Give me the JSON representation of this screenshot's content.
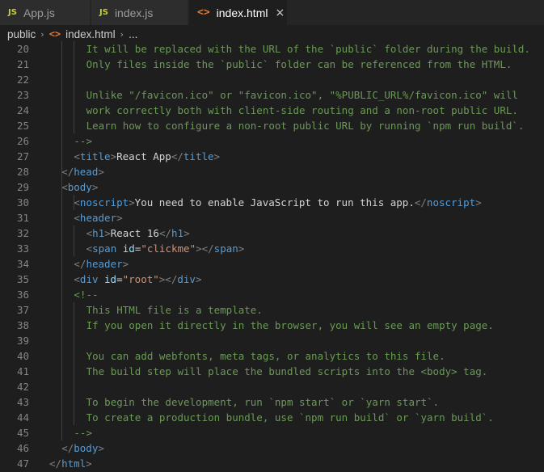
{
  "tabs": [
    {
      "badge": "JS",
      "name": "App.js",
      "active": false
    },
    {
      "badge": "JS",
      "name": "index.js",
      "active": false
    },
    {
      "badge": "<>",
      "name": "index.html",
      "active": true,
      "close": "×"
    }
  ],
  "breadcrumb": {
    "folder": "public",
    "separator": "›",
    "file_icon": "<>",
    "file": "index.html",
    "tail": "..."
  },
  "editor": {
    "lines": [
      {
        "n": "20",
        "indent": 3,
        "tokens": [
          {
            "t": "It will be replaced with the URL of the `public` folder during the build.",
            "c": "comment"
          }
        ]
      },
      {
        "n": "21",
        "indent": 3,
        "tokens": [
          {
            "t": "Only files inside the `public` folder can be referenced from the HTML.",
            "c": "comment"
          }
        ]
      },
      {
        "n": "22",
        "indent": 0,
        "tokens": []
      },
      {
        "n": "23",
        "indent": 3,
        "tokens": [
          {
            "t": "Unlike \"/favicon.ico\" or \"favicon.ico\", \"%PUBLIC_URL%/favicon.ico\" will",
            "c": "comment"
          }
        ]
      },
      {
        "n": "24",
        "indent": 3,
        "tokens": [
          {
            "t": "work correctly both with client-side routing and a non-root public URL.",
            "c": "comment"
          }
        ]
      },
      {
        "n": "25",
        "indent": 3,
        "tokens": [
          {
            "t": "Learn how to configure a non-root public URL by running `npm run build`.",
            "c": "comment"
          }
        ]
      },
      {
        "n": "26",
        "indent": 2,
        "tokens": [
          {
            "t": "-->",
            "c": "comment"
          }
        ]
      },
      {
        "n": "27",
        "indent": 2,
        "tokens": [
          {
            "t": "<",
            "c": "punct"
          },
          {
            "t": "title",
            "c": "tag"
          },
          {
            "t": ">",
            "c": "punct"
          },
          {
            "t": "React App",
            "c": "text"
          },
          {
            "t": "</",
            "c": "punct"
          },
          {
            "t": "title",
            "c": "tag"
          },
          {
            "t": ">",
            "c": "punct"
          }
        ]
      },
      {
        "n": "28",
        "indent": 1,
        "tokens": [
          {
            "t": "</",
            "c": "punct"
          },
          {
            "t": "head",
            "c": "tag"
          },
          {
            "t": ">",
            "c": "punct"
          }
        ]
      },
      {
        "n": "29",
        "indent": 1,
        "tokens": [
          {
            "t": "<",
            "c": "punct"
          },
          {
            "t": "body",
            "c": "tag"
          },
          {
            "t": ">",
            "c": "punct"
          }
        ]
      },
      {
        "n": "30",
        "indent": 2,
        "tokens": [
          {
            "t": "<",
            "c": "punct"
          },
          {
            "t": "noscript",
            "c": "tag"
          },
          {
            "t": ">",
            "c": "punct"
          },
          {
            "t": "You need to enable JavaScript to run this app.",
            "c": "text"
          },
          {
            "t": "</",
            "c": "punct"
          },
          {
            "t": "noscript",
            "c": "tag"
          },
          {
            "t": ">",
            "c": "punct"
          }
        ]
      },
      {
        "n": "31",
        "indent": 2,
        "tokens": [
          {
            "t": "<",
            "c": "punct"
          },
          {
            "t": "header",
            "c": "tag"
          },
          {
            "t": ">",
            "c": "punct"
          }
        ]
      },
      {
        "n": "32",
        "indent": 3,
        "tokens": [
          {
            "t": "<",
            "c": "punct"
          },
          {
            "t": "h1",
            "c": "tag"
          },
          {
            "t": ">",
            "c": "punct"
          },
          {
            "t": "React 16",
            "c": "text"
          },
          {
            "t": "</",
            "c": "punct"
          },
          {
            "t": "h1",
            "c": "tag"
          },
          {
            "t": ">",
            "c": "punct"
          }
        ]
      },
      {
        "n": "33",
        "indent": 3,
        "tokens": [
          {
            "t": "<",
            "c": "punct"
          },
          {
            "t": "span",
            "c": "tag"
          },
          {
            "t": " ",
            "c": "text"
          },
          {
            "t": "id",
            "c": "attr"
          },
          {
            "t": "=",
            "c": "text"
          },
          {
            "t": "\"clickme\"",
            "c": "str"
          },
          {
            "t": "></",
            "c": "punct"
          },
          {
            "t": "span",
            "c": "tag"
          },
          {
            "t": ">",
            "c": "punct"
          }
        ]
      },
      {
        "n": "34",
        "indent": 2,
        "tokens": [
          {
            "t": "</",
            "c": "punct"
          },
          {
            "t": "header",
            "c": "tag"
          },
          {
            "t": ">",
            "c": "punct"
          }
        ]
      },
      {
        "n": "35",
        "indent": 2,
        "tokens": [
          {
            "t": "<",
            "c": "punct"
          },
          {
            "t": "div",
            "c": "tag"
          },
          {
            "t": " ",
            "c": "text"
          },
          {
            "t": "id",
            "c": "attr"
          },
          {
            "t": "=",
            "c": "text"
          },
          {
            "t": "\"root\"",
            "c": "str"
          },
          {
            "t": "></",
            "c": "punct"
          },
          {
            "t": "div",
            "c": "tag"
          },
          {
            "t": ">",
            "c": "punct"
          }
        ]
      },
      {
        "n": "36",
        "indent": 2,
        "tokens": [
          {
            "t": "<!--",
            "c": "comment"
          }
        ]
      },
      {
        "n": "37",
        "indent": 3,
        "tokens": [
          {
            "t": "This HTML file is a template.",
            "c": "comment"
          }
        ]
      },
      {
        "n": "38",
        "indent": 3,
        "tokens": [
          {
            "t": "If you open it directly in the browser, you will see an empty page.",
            "c": "comment"
          }
        ]
      },
      {
        "n": "39",
        "indent": 0,
        "tokens": []
      },
      {
        "n": "40",
        "indent": 3,
        "tokens": [
          {
            "t": "You can add webfonts, meta tags, or analytics to this file.",
            "c": "comment"
          }
        ]
      },
      {
        "n": "41",
        "indent": 3,
        "tokens": [
          {
            "t": "The build step will place the bundled scripts into the <body> tag.",
            "c": "comment"
          }
        ]
      },
      {
        "n": "42",
        "indent": 0,
        "tokens": []
      },
      {
        "n": "43",
        "indent": 3,
        "tokens": [
          {
            "t": "To begin the development, run `npm start` or `yarn start`.",
            "c": "comment"
          }
        ]
      },
      {
        "n": "44",
        "indent": 3,
        "tokens": [
          {
            "t": "To create a production bundle, use `npm run build` or `yarn build`.",
            "c": "comment"
          }
        ]
      },
      {
        "n": "45",
        "indent": 2,
        "tokens": [
          {
            "t": "-->",
            "c": "comment"
          }
        ]
      },
      {
        "n": "46",
        "indent": 1,
        "tokens": [
          {
            "t": "</",
            "c": "punct"
          },
          {
            "t": "body",
            "c": "tag"
          },
          {
            "t": ">",
            "c": "punct"
          }
        ]
      },
      {
        "n": "47",
        "indent": 0,
        "tokens": [
          {
            "t": "</",
            "c": "punct"
          },
          {
            "t": "html",
            "c": "tag"
          },
          {
            "t": ">",
            "c": "punct"
          }
        ]
      }
    ]
  },
  "colors": {
    "editor_bg": "#1e1e1e",
    "tabbar_bg": "#252526",
    "comment": "#6a9955",
    "tag": "#569cd6",
    "attr": "#9cdcfe",
    "string": "#ce9178",
    "line_number": "#858585"
  }
}
